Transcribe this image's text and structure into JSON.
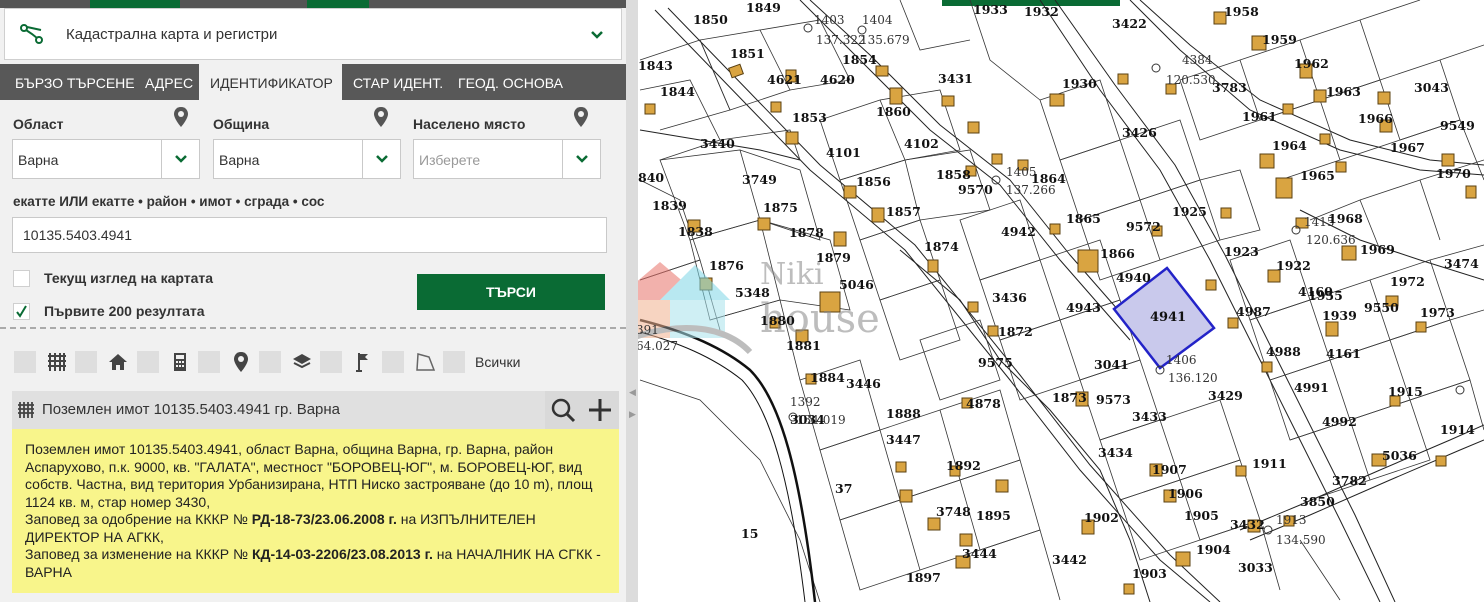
{
  "app": {
    "title": "Кадастрална карта и регистри"
  },
  "tabs": [
    {
      "label": "БЪРЗО ТЪРСЕНЕ",
      "active": false
    },
    {
      "label": "АДРЕС",
      "active": false
    },
    {
      "label": "ИДЕНТИФИКАТОР",
      "active": true
    },
    {
      "label": "СТАР ИДЕНТ.",
      "active": false
    },
    {
      "label": "ГЕОД. ОСНОВА",
      "active": false
    }
  ],
  "form": {
    "region": {
      "label": "Област",
      "value": "Варна"
    },
    "municipality": {
      "label": "Община",
      "value": "Варна"
    },
    "settlement": {
      "label": "Населено място",
      "placeholder": "Изберете"
    },
    "id_hint": "екатте ИЛИ екатте • район • имот • сграда • сос",
    "id_value": "10135.5403.4941",
    "current_view": {
      "label": "Текущ изглед на картата",
      "checked": false
    },
    "first_200": {
      "label": "Първите 200 резултата",
      "checked": true
    },
    "search_button": "ТЪРСИ"
  },
  "filters": {
    "icons": [
      "grid-icon",
      "home-icon",
      "calculator-icon",
      "pin-icon",
      "layers-icon",
      "flag-icon",
      "polygon-icon"
    ],
    "all_label": "Всички"
  },
  "result": {
    "title": "Поземлен имот 10135.5403.4941 гр. Варна",
    "line1": "Поземлен имот 10135.5403.4941, област Варна, община Варна, гр. Варна, район Аспарухово, п.к. 9000, кв. \"ГАЛАТА\", местност \"БОРОВЕЦ-ЮГ\", м. БОРОВЕЦ-ЮГ, вид собств. Частна, вид територия Урбанизирана, НТП Ниско застрояване (до 10 m), площ 1124 кв. м, стар номер 3430,",
    "order1_prefix": "Заповед за одобрение на КККР №",
    "order1_number": "РД-18-73/23.06.2008 г.",
    "order1_suffix": "на ИЗПЪЛНИТЕЛЕН ДИРЕКТОР НА АГКК,",
    "order2_prefix": "Заповед за изменение на КККР №",
    "order2_number": "КД-14-03-2206/23.08.2013 г.",
    "order2_suffix": "на НАЧАЛНИК НА СГКК - ВАРНА"
  },
  "map": {
    "highlight_parcel": "4941",
    "highlight_color": "#c9c9ec",
    "highlight_stroke": "#2323c8",
    "watermark": "Niki house",
    "parcels": [
      "1850",
      "1849",
      "1851",
      "1843",
      "4621",
      "4620",
      "1854",
      "1844",
      "1853",
      "1860",
      "3440",
      "4101",
      "4102",
      "3749",
      "1856",
      "1858",
      "9570",
      "1864",
      "1875",
      "1857",
      "1865",
      "1839",
      "1838",
      "1878",
      "1874",
      "4942",
      "1876",
      "1879",
      "5348",
      "5046",
      "3436",
      "1880",
      "1872",
      "4943",
      "1881",
      "9575",
      "1884",
      "3446",
      "1888",
      "1930",
      "3431",
      "3426",
      "1925",
      "4940",
      "3422",
      "1933",
      "1932",
      "1958",
      "1959",
      "1962",
      "1963",
      "1961",
      "1966",
      "1964",
      "1967",
      "1965",
      "1968",
      "1969",
      "1970",
      "1922",
      "4160",
      "1939",
      "9550",
      "1923",
      "4987",
      "4988",
      "4161",
      "4991",
      "4992",
      "1972",
      "1973",
      "3474",
      "3043",
      "9549",
      "3783",
      "1915",
      "1914",
      "5036",
      "3782",
      "3850",
      "1911",
      "3429",
      "3433",
      "3434",
      "1907",
      "1906",
      "1905",
      "1904",
      "1902",
      "1903",
      "3442",
      "3033",
      "3432",
      "3447",
      "1892",
      "3748",
      "1895",
      "3444",
      "1897",
      "4878",
      "3041",
      "9573",
      "9572",
      "1866",
      "1873",
      "37",
      "15",
      "840",
      "3034",
      "1955"
    ],
    "points": [
      {
        "id": "1403",
        "value": "137.322"
      },
      {
        "id": "1404",
        "value": "135.679"
      },
      {
        "id": "1405",
        "value": "137.266"
      },
      {
        "id": "4384",
        "value": "120.530"
      },
      {
        "id": "1415",
        "value": "120.636"
      },
      {
        "id": "1406",
        "value": "136.120"
      },
      {
        "id": "1392",
        "value": "134.019"
      },
      {
        "id": "1913",
        "value": "134.590"
      },
      {
        "id": "391",
        "value": "64.027"
      }
    ]
  }
}
